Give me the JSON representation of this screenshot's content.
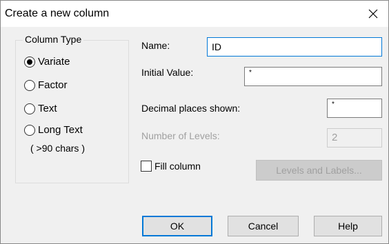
{
  "dialog": {
    "title": "Create a new column",
    "close_icon": "close-icon"
  },
  "column_type": {
    "legend": "Column Type",
    "options": [
      {
        "label": "Variate",
        "selected": true
      },
      {
        "label": "Factor",
        "selected": false
      },
      {
        "label": "Text",
        "selected": false
      },
      {
        "label": "Long Text",
        "selected": false
      }
    ],
    "long_text_note": "( >90 chars )"
  },
  "form": {
    "name_label": "Name:",
    "name_value": "ID",
    "initial_value_label": "Initial Value:",
    "initial_value": "*",
    "decimal_places_label": "Decimal places shown:",
    "decimal_places_value": "*",
    "number_of_levels_label": "Number of Levels:",
    "number_of_levels_value": "2",
    "fill_column_label": "Fill column",
    "fill_column_checked": false
  },
  "buttons": {
    "levels_and_labels": "Levels and Labels...",
    "ok": "OK",
    "cancel": "Cancel",
    "help": "Help"
  },
  "colors": {
    "focus_accent": "#0078d7",
    "disabled_text": "#a0a0a0"
  }
}
